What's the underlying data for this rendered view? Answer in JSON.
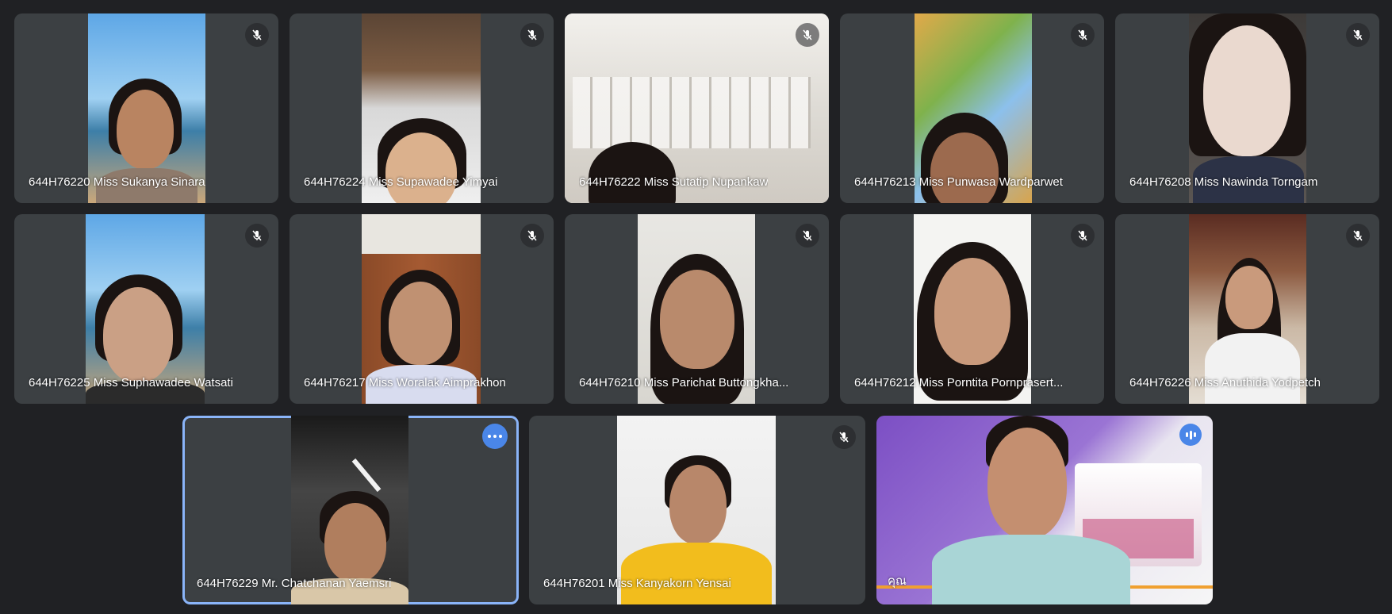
{
  "participants": [
    {
      "name": "644H76220 Miss Sukanya Sinara",
      "muted": true
    },
    {
      "name": "644H76224 Miss Supawadee Yimyai",
      "muted": true
    },
    {
      "name": "644H76222 Miss Sutatip Nupankaw",
      "muted": true
    },
    {
      "name": "644H76213 Miss Punwasa Wardparwet",
      "muted": true
    },
    {
      "name": "644H76208 Miss Nawinda Torngam",
      "muted": true
    },
    {
      "name": "644H76225 Miss Suphawadee Watsati",
      "muted": true
    },
    {
      "name": "644H76217 Miss Woralak Aimprakhon",
      "muted": true
    },
    {
      "name": "644H76210 Miss Parichat Buttongkha...",
      "muted": true
    },
    {
      "name": "644H76212 Miss Porntita Pornprasert...",
      "muted": true
    },
    {
      "name": "644H76226 Miss Anuthida Yodpetch",
      "muted": true
    },
    {
      "name": "644H76229 Mr. Chatchanan Yaemsri",
      "muted": false
    },
    {
      "name": "644H76201 Miss Kanyakorn Yensai",
      "muted": true
    },
    {
      "name": "คุณ",
      "muted": false
    }
  ],
  "icons": {
    "muted": "mic-off-icon",
    "more": "more-options-icon",
    "speaking": "speaking-icon"
  },
  "colors": {
    "background": "#202124",
    "tile": "#3c4043",
    "accent": "#8ab4f8",
    "button": "#4a86e8"
  }
}
